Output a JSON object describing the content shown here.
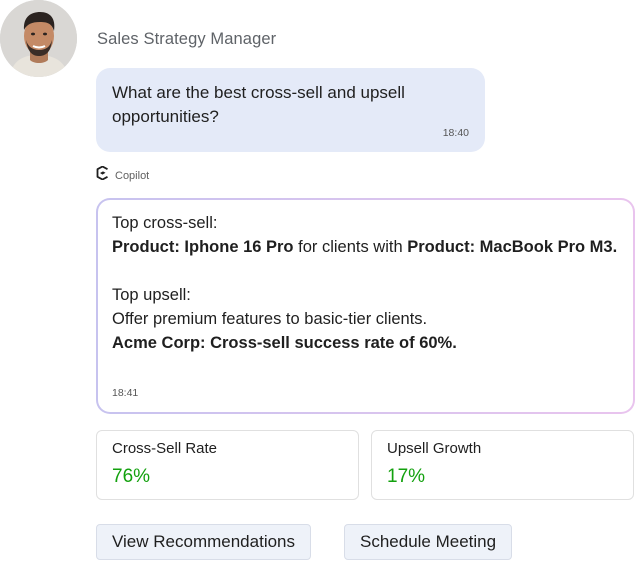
{
  "sender": {
    "name": "Sales Strategy Manager"
  },
  "user_message": {
    "text": "What are the best cross-sell and upsell opportunities?",
    "time": "18:40"
  },
  "copilot": {
    "label": "Copilot",
    "icon": "copilot-logo-icon"
  },
  "bot_message": {
    "line1": "Top cross-sell:",
    "cross_sell_product_a": "Product: Iphone 16 Pro",
    "cross_sell_connector": " for clients with ",
    "cross_sell_product_b": "Product: MacBook Pro M3.",
    "line3": "Top upsell:",
    "line4": "Offer premium features to basic-tier clients.",
    "line5": "Acme Corp: Cross-sell success rate of 60%.",
    "time": "18:41"
  },
  "metrics": [
    {
      "label": "Cross-Sell Rate",
      "value": "76%"
    },
    {
      "label": "Upsell Growth",
      "value": "17%"
    }
  ],
  "actions": {
    "view_label": "View Recommendations",
    "schedule_label": "Schedule Meeting"
  },
  "colors": {
    "user_bubble": "#e4eaf8",
    "metric_value": "#13a10e",
    "bot_border_start": "#c7c3ef",
    "bot_border_end": "#e9c4ee"
  }
}
